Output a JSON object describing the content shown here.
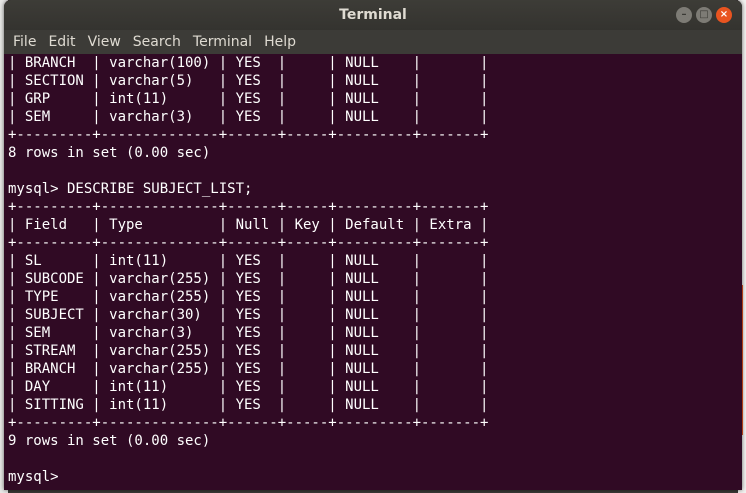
{
  "window": {
    "title": "Terminal",
    "controls": {
      "minimize": "–",
      "maximize": "□",
      "close": "×"
    }
  },
  "menu": {
    "items": [
      "File",
      "Edit",
      "View",
      "Search",
      "Terminal",
      "Help"
    ]
  },
  "terminal": {
    "lines": [
      "| BRANCH  | varchar(100) | YES  |     | NULL    |       |",
      "| SECTION | varchar(5)   | YES  |     | NULL    |       |",
      "| GRP     | int(11)      | YES  |     | NULL    |       |",
      "| SEM     | varchar(3)   | YES  |     | NULL    |       |",
      "+---------+--------------+------+-----+---------+-------+",
      "8 rows in set (0.00 sec)",
      "",
      "mysql> DESCRIBE SUBJECT_LIST;",
      "+---------+--------------+------+-----+---------+-------+",
      "| Field   | Type         | Null | Key | Default | Extra |",
      "+---------+--------------+------+-----+---------+-------+",
      "| SL      | int(11)      | YES  |     | NULL    |       |",
      "| SUBCODE | varchar(255) | YES  |     | NULL    |       |",
      "| TYPE    | varchar(255) | YES  |     | NULL    |       |",
      "| SUBJECT | varchar(30)  | YES  |     | NULL    |       |",
      "| SEM     | varchar(3)   | YES  |     | NULL    |       |",
      "| STREAM  | varchar(255) | YES  |     | NULL    |       |",
      "| BRANCH  | varchar(255) | YES  |     | NULL    |       |",
      "| DAY     | int(11)      | YES  |     | NULL    |       |",
      "| SITTING | int(11)      | YES  |     | NULL    |       |",
      "+---------+--------------+------+-----+---------+-------+",
      "9 rows in set (0.00 sec)",
      "",
      "mysql> "
    ]
  },
  "colors": {
    "terminal_bg": "#300a24",
    "titlebar_bg": "#3c3b37",
    "close_accent": "#e95420",
    "text": "#ffffff"
  }
}
